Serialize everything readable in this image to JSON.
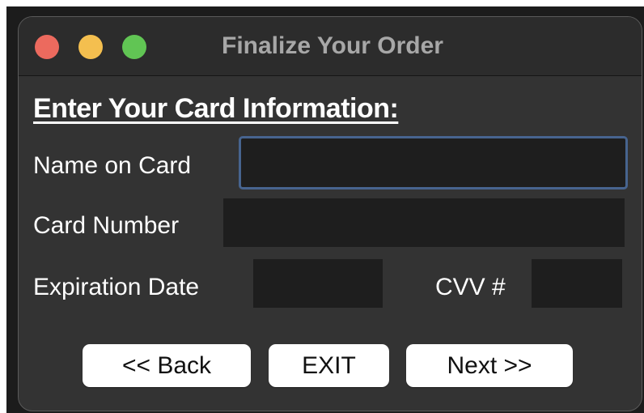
{
  "window": {
    "title": "Finalize Your Order",
    "traffic_lights": {
      "close_color": "#ec6a5e",
      "minimize_color": "#f4bf4f",
      "zoom_color": "#61c554"
    }
  },
  "form": {
    "heading": "Enter Your Card Information:",
    "name_label": "Name on Card",
    "name_value": "",
    "number_label": "Card Number",
    "number_value": "",
    "expiration_label": "Expiration Date",
    "expiration_value": "",
    "cvv_label": "CVV #",
    "cvv_value": ""
  },
  "buttons": {
    "back_label": "<< Back",
    "exit_label": "EXIT",
    "next_label": "Next >>"
  },
  "colors": {
    "focus_border": "#47648f",
    "window_background": "#333333",
    "field_background": "#1e1e1e"
  }
}
